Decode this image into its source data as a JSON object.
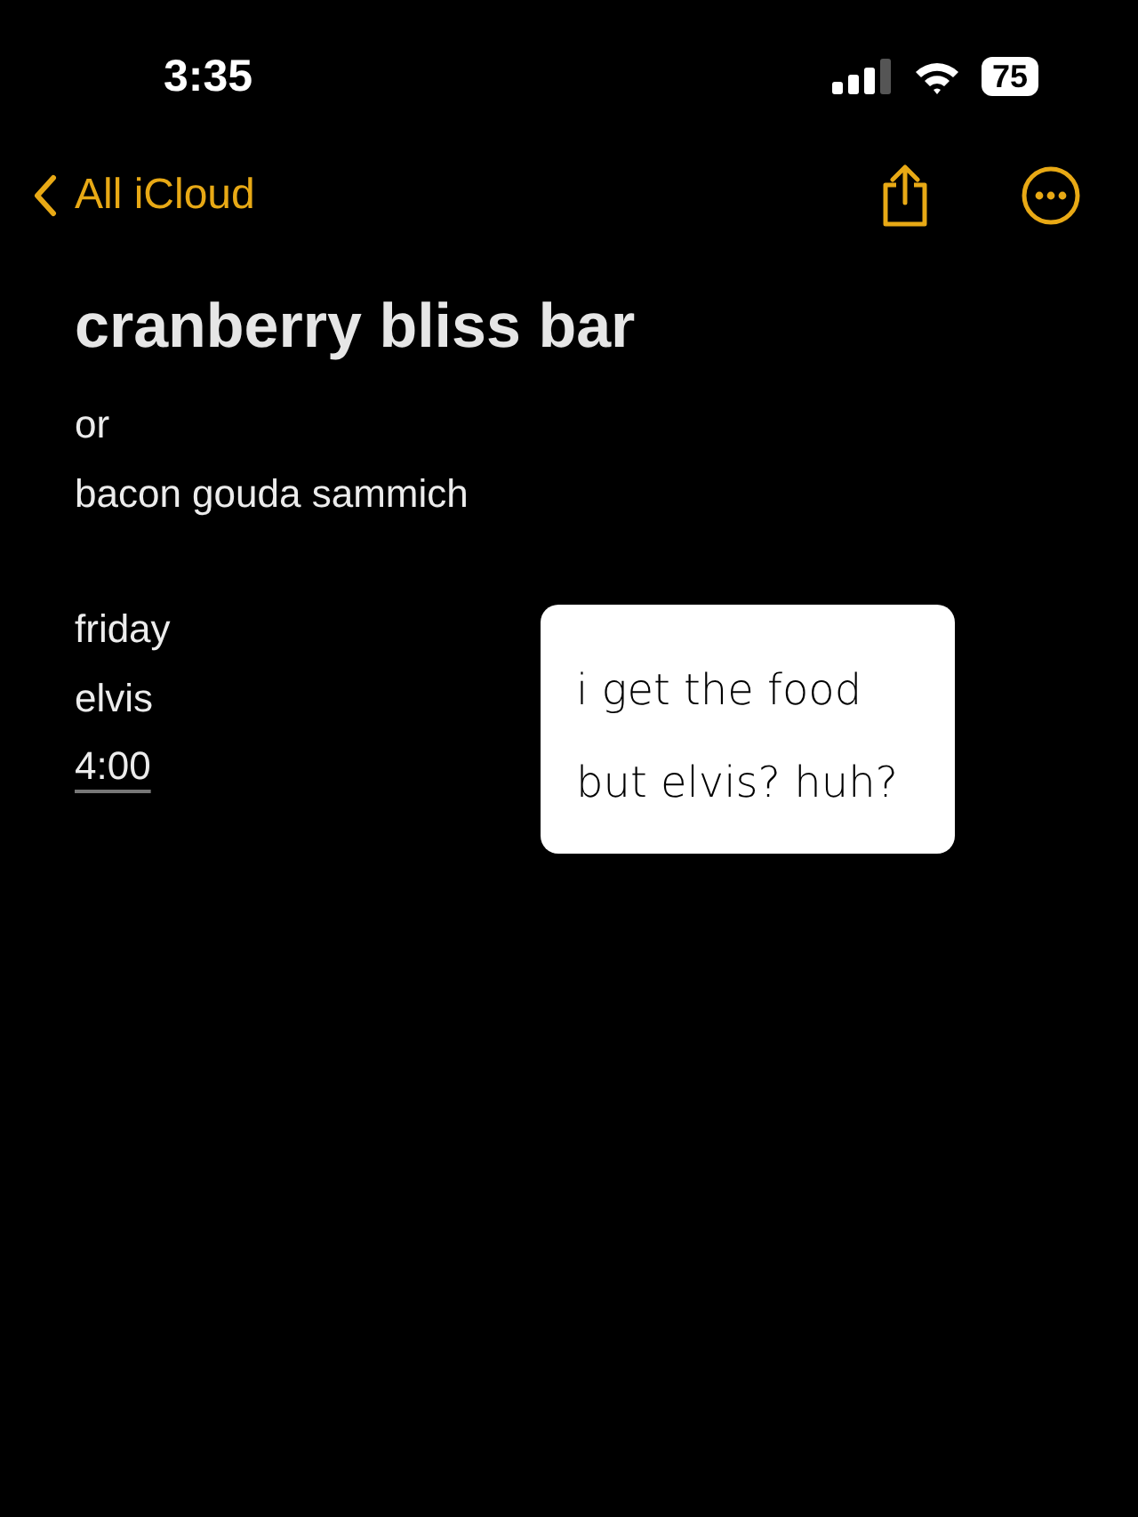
{
  "status_bar": {
    "time": "3:35",
    "battery": "75"
  },
  "nav": {
    "back_label": "All iCloud"
  },
  "note": {
    "title": "cranberry bliss bar",
    "blocks": [
      {
        "lines": [
          {
            "text": "or",
            "kind": "text"
          },
          {
            "text": "bacon gouda sammich",
            "kind": "text"
          }
        ]
      },
      {
        "lines": [
          {
            "text": "friday",
            "kind": "text"
          },
          {
            "text": "elvis",
            "kind": "text"
          },
          {
            "text": "4:00",
            "kind": "link"
          }
        ]
      }
    ]
  },
  "sticker": {
    "lines": [
      "i get the food",
      "but elvis? huh?"
    ]
  }
}
